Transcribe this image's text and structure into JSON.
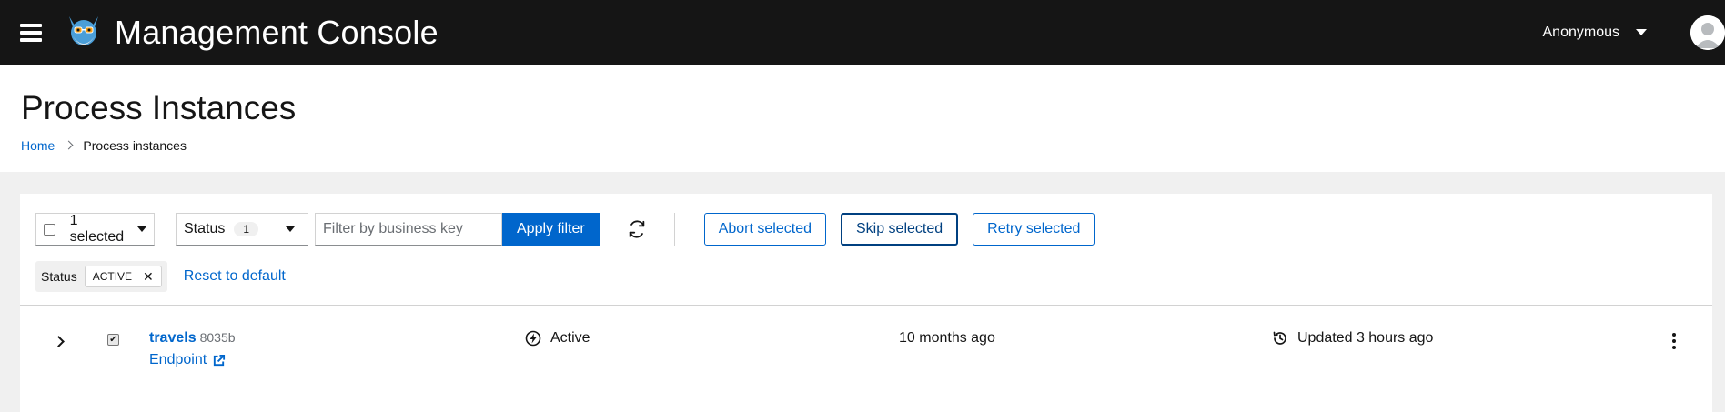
{
  "masthead": {
    "title": "Management Console",
    "user": "Anonymous"
  },
  "page": {
    "title": "Process Instances",
    "breadcrumb": {
      "home": "Home",
      "current": "Process instances"
    }
  },
  "toolbar": {
    "bulk_select_label": "1 selected",
    "status_label": "Status",
    "status_count": "1",
    "filter_placeholder": "Filter by business key",
    "apply_label": "Apply filter",
    "abort_label": "Abort selected",
    "skip_label": "Skip selected",
    "retry_label": "Retry selected"
  },
  "chips": {
    "category": "Status",
    "value": "ACTIVE",
    "reset_label": "Reset to default"
  },
  "rows": [
    {
      "name": "travels",
      "id": "8035b",
      "endpoint": "Endpoint",
      "state": "Active",
      "created": "10 months ago",
      "updated": "Updated 3 hours ago",
      "selected": true
    }
  ],
  "colors": {
    "masthead_bg": "#151515",
    "link": "#0066cc",
    "primary": "#0066cc"
  }
}
